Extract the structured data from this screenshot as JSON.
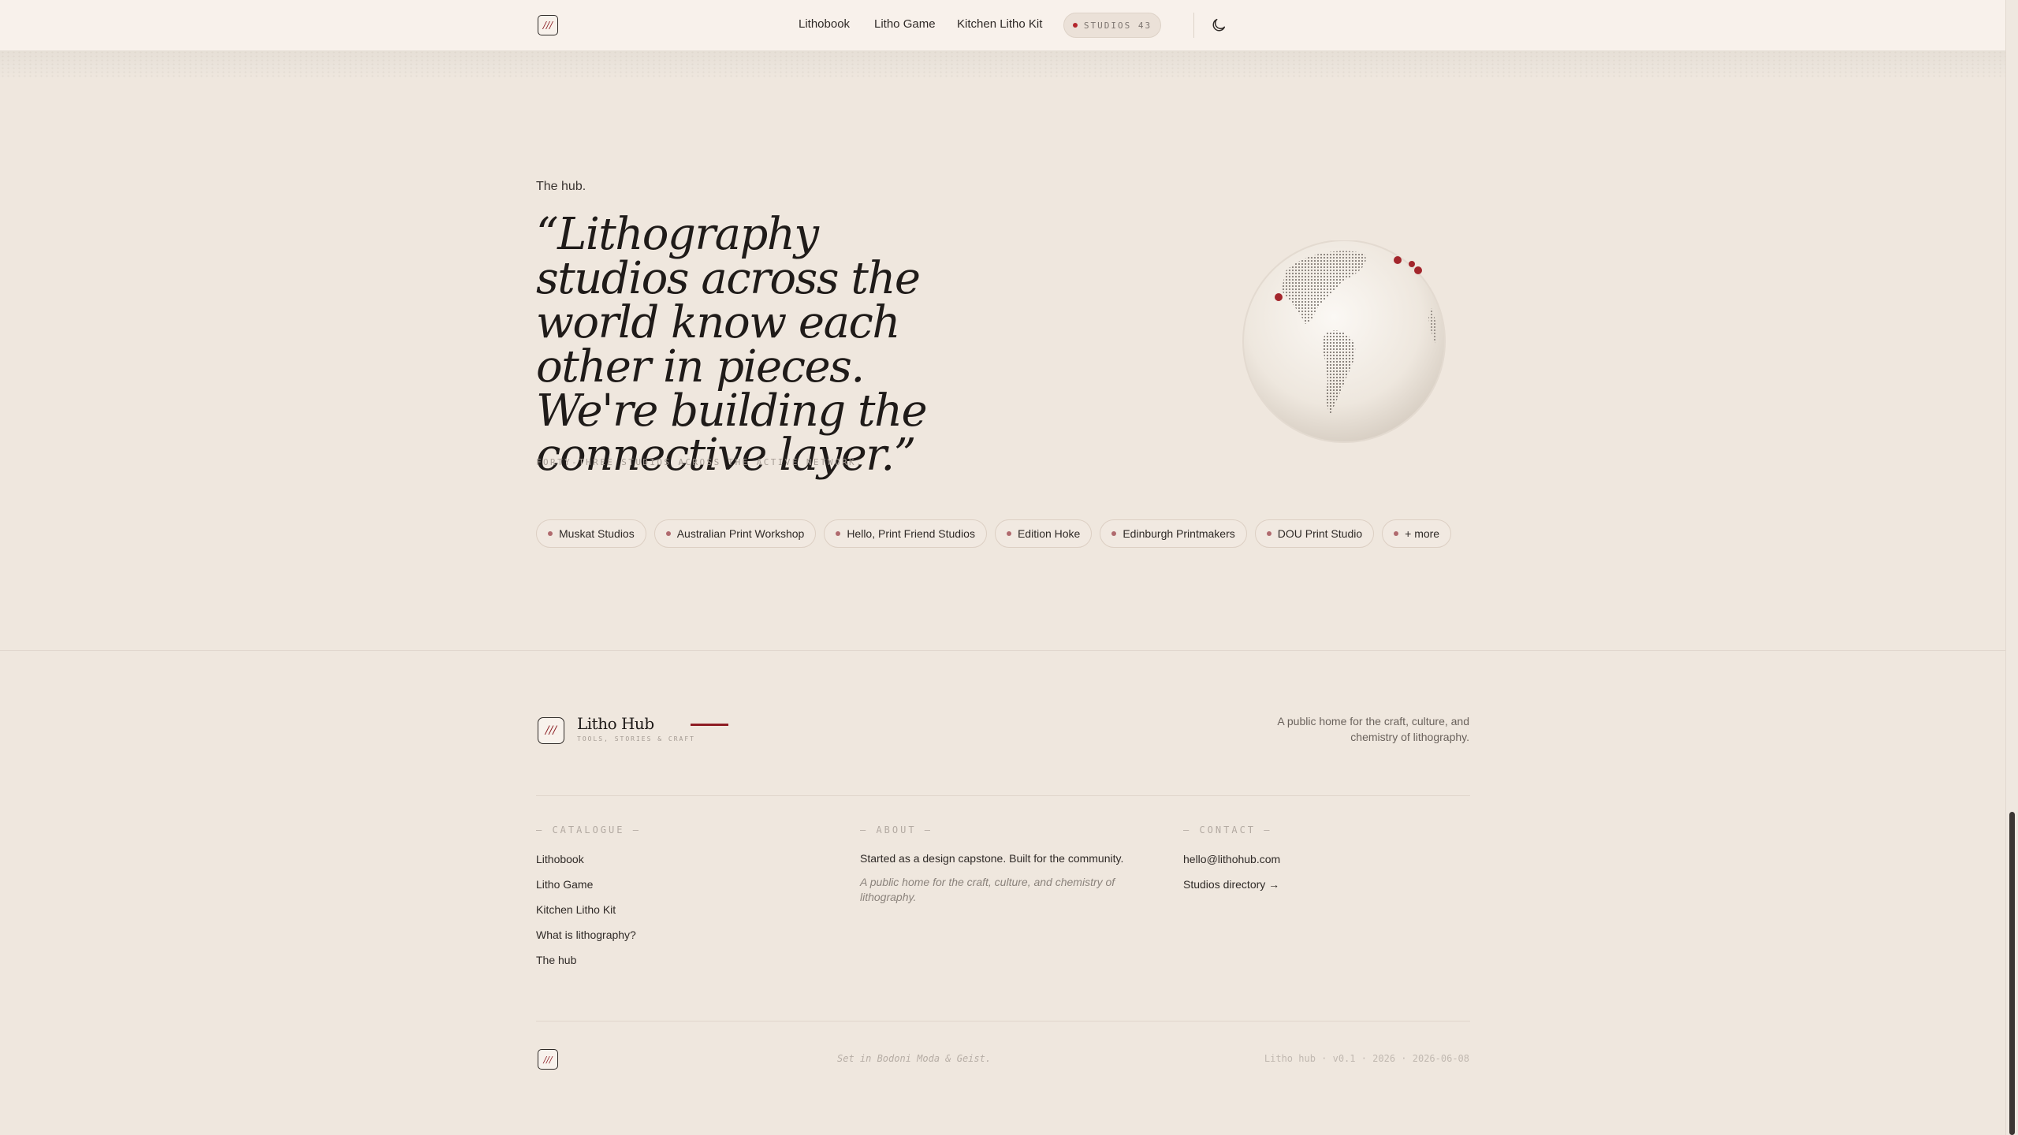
{
  "nav": {
    "logo_text": "///",
    "links": [
      "Lithobook",
      "Litho Game",
      "Kitchen Litho Kit"
    ],
    "studios_pill": "STUDIOS 43"
  },
  "hero": {
    "kicker": "The hub.",
    "quote": "“Lithography studios across the world know each other in pieces. We're building the connective layer.”",
    "subline": "FORTY-THREE STUDIOS ACROSS THE ACTIVE NETWORK.",
    "chips": [
      "Muskat Studios",
      "Australian Print Workshop",
      "Hello, Print Friend Studios",
      "Edition Hoke",
      "Edinburgh Printmakers",
      "DOU Print Studio",
      "+ more"
    ],
    "globe_accent": "#b3262d"
  },
  "footer": {
    "brand": "Litho Hub",
    "tagline": "TOOLS, STORIES & CRAFT",
    "description": "A public home for the craft, culture, and chemistry of lithography.",
    "catalogue": {
      "heading": "— CATALOGUE —",
      "links": [
        "Lithobook",
        "Litho Game",
        "Kitchen Litho Kit",
        "What is lithography?",
        "The hub"
      ]
    },
    "about": {
      "heading": "— ABOUT —",
      "text": "Started as a design capstone. Built for the community.",
      "italic": "A public home for the craft, culture, and chemistry of lithography."
    },
    "contact": {
      "heading": "— CONTACT —",
      "email": "hello@lithohub.com",
      "directory": "Studios directory →"
    },
    "bottom": {
      "set_in": "Set in Bodoni Moda & Geist.",
      "version": "Litho hub · v0.1 · 2026 · 2026-06-08"
    }
  },
  "colors": {
    "background": "#efe7de",
    "nav": "#f8f1eb",
    "accent": "#8e1d24"
  }
}
